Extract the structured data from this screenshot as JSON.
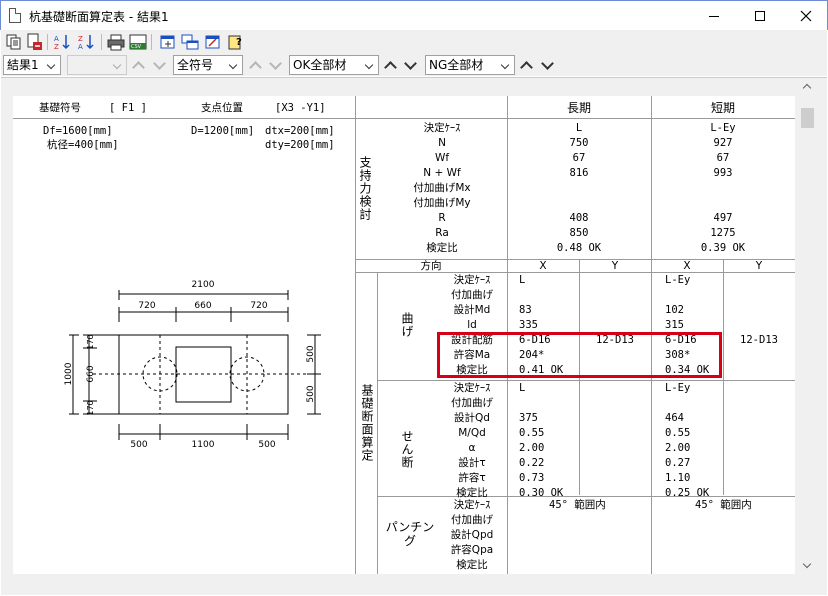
{
  "window": {
    "title": "杭基礎断面算定表 - 結果1"
  },
  "filters": {
    "result": "結果1",
    "blank": "",
    "symbol": "全符号",
    "ok_members": "OK全部材",
    "ng_members": "NG全部材"
  },
  "header": {
    "symbol_label": "基礎符号",
    "symbol_value": "[ F1 ]",
    "position_label": "支点位置",
    "position_value": "[X3  -Y1]",
    "long_term": "長期",
    "short_term": "短期"
  },
  "params": {
    "df": "Df=1600[mm]",
    "pile_dia": "杭径=400[mm]",
    "d": "D=1200[mm]",
    "dtx": "dtx=200[mm]",
    "dty": "dty=200[mm]"
  },
  "support": {
    "section": "支持力検討",
    "rows": [
      {
        "label": "決定ｹｰｽ",
        "long": "L",
        "short": "L-Ey"
      },
      {
        "label": "N",
        "long": "750",
        "short": "927"
      },
      {
        "label": "Wf",
        "long": "67",
        "short": "67"
      },
      {
        "label": "N + Wf",
        "long": "816",
        "short": "993"
      },
      {
        "label": "付加曲げMx",
        "long": "",
        "short": ""
      },
      {
        "label": "付加曲げMy",
        "long": "",
        "short": ""
      },
      {
        "label": "R",
        "long": "408",
        "short": "497"
      },
      {
        "label": "Ra",
        "long": "850",
        "short": "1275"
      },
      {
        "label": "検定比",
        "long": "0.48  OK",
        "short": "0.39  OK"
      }
    ]
  },
  "direction": {
    "label": "方向",
    "x": "X",
    "y": "Y"
  },
  "section_calc": {
    "section": "基礎断面算定",
    "bending": {
      "label": "曲げ",
      "rows": [
        {
          "label": "決定ｹｰｽ",
          "lx": "L",
          "ly": "",
          "sx": "L-Ey",
          "sy": ""
        },
        {
          "label": "付加曲げ",
          "lx": "",
          "ly": "",
          "sx": "",
          "sy": ""
        },
        {
          "label": "設計Md",
          "lx": "83",
          "ly": "",
          "sx": "102",
          "sy": ""
        },
        {
          "label": "ld",
          "lx": "335",
          "ly": "",
          "sx": "315",
          "sy": ""
        },
        {
          "label": "設計配筋",
          "lx": "6-D16",
          "ly": "12-D13",
          "sx": "6-D16",
          "sy": "12-D13"
        },
        {
          "label": "許容Ma",
          "lx": "204*",
          "ly": "",
          "sx": "308*",
          "sy": ""
        },
        {
          "label": "検定比",
          "lx": "0.41  OK",
          "ly": "",
          "sx": "0.34  OK",
          "sy": ""
        }
      ]
    },
    "shear": {
      "label": "せん断",
      "rows": [
        {
          "label": "決定ｹｰｽ",
          "lx": "L",
          "sx": "L-Ey"
        },
        {
          "label": "付加曲げ",
          "lx": "",
          "sx": ""
        },
        {
          "label": "設計Qd",
          "lx": "375",
          "sx": "464"
        },
        {
          "label": "M/Qd",
          "lx": "0.55",
          "sx": "0.55"
        },
        {
          "label": "α",
          "lx": "2.00",
          "sx": "2.00"
        },
        {
          "label": "設計τ",
          "lx": "0.22",
          "sx": "0.27"
        },
        {
          "label": "許容τ",
          "lx": "0.73",
          "sx": "1.10"
        },
        {
          "label": "検定比",
          "lx": "0.30  OK",
          "sx": "0.25  OK"
        }
      ]
    },
    "punching": {
      "label": "パンチング",
      "rows": [
        {
          "label": "決定ｹｰｽ",
          "long": "45° 範囲内",
          "short": "45° 範囲内"
        },
        {
          "label": "付加曲げ",
          "long": "",
          "short": ""
        },
        {
          "label": "設計Qpd",
          "long": "",
          "short": ""
        },
        {
          "label": "許容Qpa",
          "long": "",
          "short": ""
        },
        {
          "label": "検定比",
          "long": "",
          "short": ""
        }
      ]
    }
  },
  "drawing": {
    "total_width": "2100",
    "top_dims": [
      "720",
      "660",
      "720"
    ],
    "bottom_dims": [
      "500",
      "1100",
      "500"
    ],
    "left_total": "1000",
    "left_dims": [
      "170",
      "660",
      "170"
    ],
    "right_dims": [
      "500",
      "500"
    ]
  },
  "colors": {
    "highlight": "#d60016"
  }
}
